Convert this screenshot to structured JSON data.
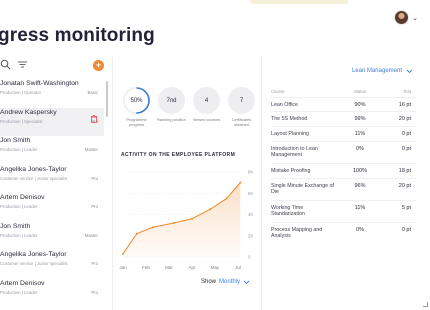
{
  "page": {
    "title": "gress monitoring"
  },
  "colors": {
    "accent": "#f08a2c",
    "link": "#3e7fd6",
    "delete": "#e0454b"
  },
  "header": {
    "avatar_icon": "user-avatar",
    "menu_icon": "chevron-down-icon"
  },
  "list_tools": {
    "search_icon": "search-icon",
    "filter_icon": "filter-icon",
    "add_label": "+"
  },
  "employees": [
    {
      "name": "Jonatan Swift-Washington",
      "sub": "Production  |  Operator",
      "level": "Basic"
    },
    {
      "name": "Andrew Kaspersky",
      "sub": "Production  |  Specialist",
      "level": "Pro",
      "selected": true
    },
    {
      "name": "Jon Smith",
      "sub": "Production  |  Leader",
      "level": "Master"
    },
    {
      "name": "Angelika Jones-Taylor",
      "sub": "Customer service  |  Junior specialist",
      "level": "Pro"
    },
    {
      "name": "Artem Denisov",
      "sub": "Production  |  Leader",
      "level": "Pro"
    },
    {
      "name": "Jon Smith",
      "sub": "Production  |  Leader",
      "level": "Master"
    },
    {
      "name": "Angelika Jones-Taylor",
      "sub": "Customer service  |  Junior specialist",
      "level": "Pro"
    },
    {
      "name": "Artem Denisov",
      "sub": "Production  |  Leader",
      "level": "Pro"
    }
  ],
  "stats": [
    {
      "value": "50%",
      "label": "Programme progress",
      "progress": 0.5
    },
    {
      "value": "7nd",
      "label": "Ranking position"
    },
    {
      "value": "4",
      "label": "Viewed courses"
    },
    {
      "value": "7",
      "label": "Certificates obtained"
    }
  ],
  "chart_data": {
    "type": "line",
    "title": "ACTIVITY ON THE EMPLOYEE PLATFORM",
    "categories": [
      "Jan",
      "Feb",
      "Mar",
      "Apr",
      "May",
      "Jul"
    ],
    "x": [
      0,
      0.6,
      1.3,
      2.2,
      3.0,
      3.8,
      4.5,
      5.1
    ],
    "values": [
      0.3,
      2.2,
      2.8,
      3.2,
      3.6,
      4.5,
      5.5,
      7.0
    ],
    "y_ticks": [
      "0",
      "2h",
      "4h",
      "6h",
      "8h"
    ],
    "ylim": [
      0,
      8
    ],
    "grid": true
  },
  "show": {
    "label": "Show",
    "value": "Monthly"
  },
  "courses": {
    "dept": "Lean Management",
    "headers": {
      "course": "Course",
      "status": "Status",
      "test": "Test"
    },
    "rows": [
      {
        "course": "Lean Office",
        "status": "90%",
        "test": "16 pt"
      },
      {
        "course": "The 5S Method",
        "status": "99%",
        "test": "20 pt"
      },
      {
        "course": "Layout Planning",
        "status": "11%",
        "test": "0 pt"
      },
      {
        "course": "Introduction to Lean Management",
        "status": "0%",
        "test": "0 pt"
      },
      {
        "course": "Mistake Proofing",
        "status": "100%",
        "test": "18 pt"
      },
      {
        "course": "Single Minute Exchange of Die",
        "status": "96%",
        "test": "20 pt"
      },
      {
        "course": "Working Time Standarization",
        "status": "11%",
        "test": "5 pt"
      },
      {
        "course": "Process Mapping and Analysis",
        "status": "0%",
        "test": "0 pt"
      }
    ]
  }
}
